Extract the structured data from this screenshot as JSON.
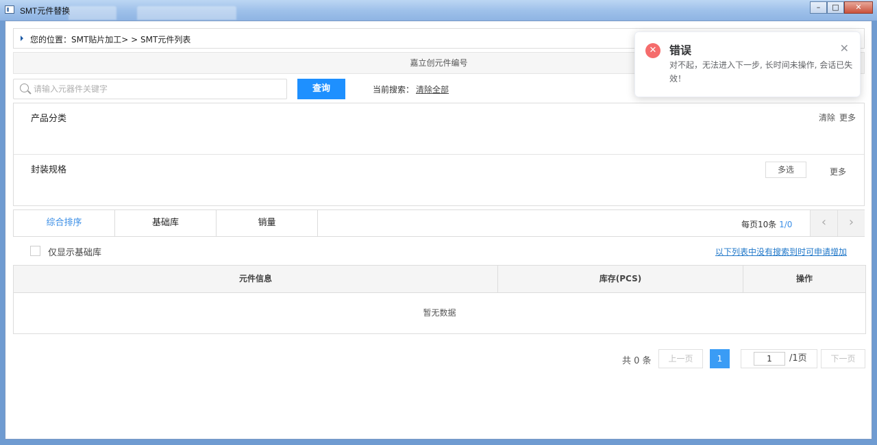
{
  "window": {
    "title": "SMT元件替换",
    "min_glyph": "–",
    "max_glyph": "□",
    "close_glyph": "✕"
  },
  "breadcrumb": {
    "text": "您的位置：SMT贴片加工> > SMT元件列表"
  },
  "strip": {
    "label": "嘉立创元件编号"
  },
  "search": {
    "placeholder": "请输入元器件关键字",
    "value": "",
    "button_label": "查询",
    "current_label": "当前搜索：",
    "clear_all": "清除全部"
  },
  "filters": {
    "category": {
      "label": "产品分类",
      "clear": "清除",
      "more": "更多"
    },
    "package": {
      "label": "封装规格",
      "multi": "多选",
      "more": "更多"
    }
  },
  "tabs": [
    {
      "label": "综合排序",
      "active": true
    },
    {
      "label": "基础库",
      "active": false
    },
    {
      "label": "销量",
      "active": false
    }
  ],
  "page_info": {
    "prefix": "每页10条",
    "current": "1/0"
  },
  "arrows": {
    "prev": "‹",
    "next": "›"
  },
  "checkbox": {
    "label": "仅显示基础库",
    "checked": false
  },
  "add_link": "以下列表中没有搜索到时可申请增加",
  "table": {
    "headers": [
      "元件信息",
      "库存(PCS)",
      "操作"
    ],
    "empty_text": "暂无数据"
  },
  "pagination": {
    "total": "共 0 条",
    "prev": "上一页",
    "current": "1",
    "jump_value": "1",
    "jump_suffix": "/1页",
    "next": "下一页"
  },
  "toast": {
    "icon_glyph": "✕",
    "title": "错误",
    "message": "对不起，无法进入下一步, 长时间未操作, 会话已失效！",
    "close_glyph": "✕",
    "color": "#f56c6c"
  },
  "colors": {
    "accent": "#1e90ff",
    "link": "#1f77c9",
    "error": "#f56c6c"
  }
}
